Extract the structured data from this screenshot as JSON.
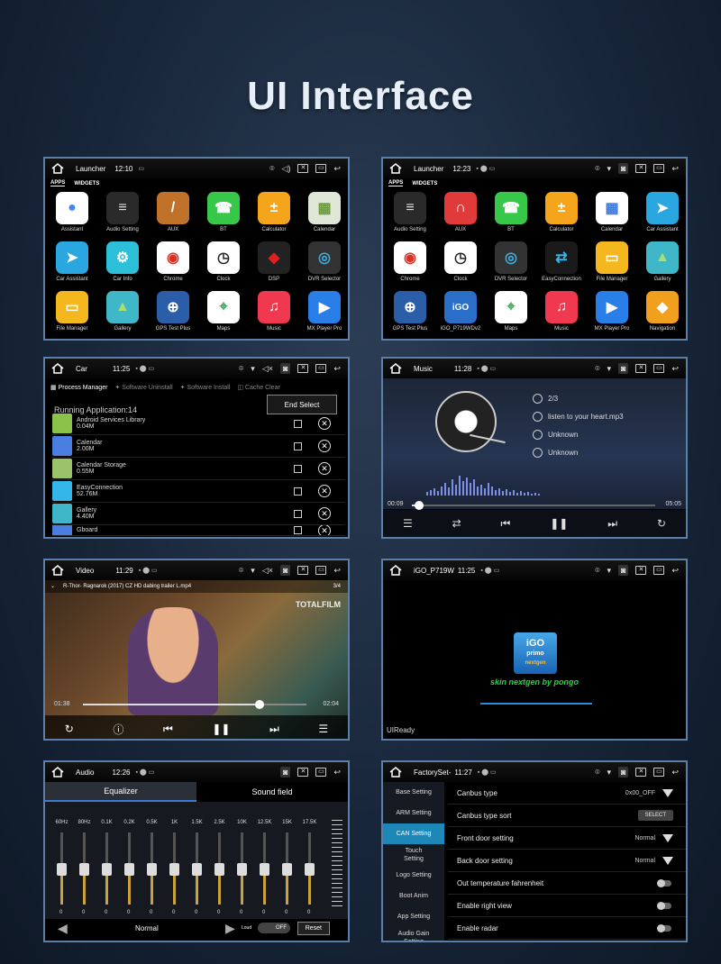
{
  "page": {
    "title": "UI Interface"
  },
  "launcher1": {
    "title": "Launcher",
    "time": "12:10",
    "tabs": [
      "APPS",
      "WIDGETS"
    ],
    "apps": [
      {
        "label": "Assistant",
        "bg": "#ffffff",
        "glyph": "●",
        "fg": "#4285f4"
      },
      {
        "label": "Audio Setting",
        "bg": "#2a2a2a",
        "glyph": "≡",
        "fg": "#ddd"
      },
      {
        "label": "AUX",
        "bg": "#c0722a",
        "glyph": "/",
        "fg": "#fff"
      },
      {
        "label": "BT",
        "bg": "#37c84a",
        "glyph": "☎",
        "fg": "#fff"
      },
      {
        "label": "Calculator",
        "bg": "#f4a51c",
        "glyph": "±",
        "fg": "#fff"
      },
      {
        "label": "Calendar",
        "bg": "#dfe8d6",
        "glyph": "▦",
        "fg": "#6a9a3a"
      },
      {
        "label": "Car Assistant",
        "bg": "#2aa6e0",
        "glyph": "➤",
        "fg": "#fff"
      },
      {
        "label": "Car Info",
        "bg": "#2bc0d8",
        "glyph": "⚙",
        "fg": "#fff"
      },
      {
        "label": "Chrome",
        "bg": "#ffffff",
        "glyph": "◉",
        "fg": "#d93025"
      },
      {
        "label": "Clock",
        "bg": "#ffffff",
        "glyph": "◷",
        "fg": "#222"
      },
      {
        "label": "DSP",
        "bg": "#222222",
        "glyph": "◆",
        "fg": "#e02020"
      },
      {
        "label": "DVR Selector",
        "bg": "#333333",
        "glyph": "◎",
        "fg": "#3fb0e0"
      },
      {
        "label": "File Manager",
        "bg": "#f5b71e",
        "glyph": "▭",
        "fg": "#fff"
      },
      {
        "label": "Gallery",
        "bg": "#3fb7c8",
        "glyph": "▲",
        "fg": "#a8e06a"
      },
      {
        "label": "GPS Test Plus",
        "bg": "#2a5ea8",
        "glyph": "⊕",
        "fg": "#fff"
      },
      {
        "label": "Maps",
        "bg": "#ffffff",
        "glyph": "⌖",
        "fg": "#34a853"
      },
      {
        "label": "Music",
        "bg": "#f0384e",
        "glyph": "♫",
        "fg": "#fff"
      },
      {
        "label": "MX Player Pro",
        "bg": "#2a7ee8",
        "glyph": "▶",
        "fg": "#fff"
      }
    ]
  },
  "launcher2": {
    "title": "Launcher",
    "time": "12:23",
    "tabs": [
      "APPS",
      "WIDGETS"
    ],
    "apps": [
      {
        "label": "Audio Setting",
        "bg": "#2a2a2a",
        "glyph": "≡",
        "fg": "#ddd"
      },
      {
        "label": "AUX",
        "bg": "#e03a3a",
        "glyph": "∩",
        "fg": "#fff"
      },
      {
        "label": "BT",
        "bg": "#37c84a",
        "glyph": "☎",
        "fg": "#fff"
      },
      {
        "label": "Calculator",
        "bg": "#f4a51c",
        "glyph": "±",
        "fg": "#fff"
      },
      {
        "label": "Calendar",
        "bg": "#ffffff",
        "glyph": "▦",
        "fg": "#3a78e0"
      },
      {
        "label": "Car Assistant",
        "bg": "#2aa6e0",
        "glyph": "➤",
        "fg": "#fff"
      },
      {
        "label": "Chrome",
        "bg": "#ffffff",
        "glyph": "◉",
        "fg": "#d93025"
      },
      {
        "label": "Clock",
        "bg": "#ffffff",
        "glyph": "◷",
        "fg": "#222"
      },
      {
        "label": "DVR Selector",
        "bg": "#333333",
        "glyph": "◎",
        "fg": "#3fb0e0"
      },
      {
        "label": "EasyConnection",
        "bg": "#1a1a1a",
        "glyph": "⇄",
        "fg": "#35b6e8"
      },
      {
        "label": "File Manager",
        "bg": "#f5b71e",
        "glyph": "▭",
        "fg": "#fff"
      },
      {
        "label": "Gallery",
        "bg": "#3fb7c8",
        "glyph": "▲",
        "fg": "#a8e06a"
      },
      {
        "label": "GPS Test Plus",
        "bg": "#2a5ea8",
        "glyph": "⊕",
        "fg": "#fff"
      },
      {
        "label": "iGO_P719WDv2",
        "bg": "#2a6ec8",
        "glyph": "iGO",
        "fg": "#fff"
      },
      {
        "label": "Maps",
        "bg": "#ffffff",
        "glyph": "⌖",
        "fg": "#34a853"
      },
      {
        "label": "Music",
        "bg": "#f0384e",
        "glyph": "♫",
        "fg": "#fff"
      },
      {
        "label": "MX Player Pro",
        "bg": "#2a7ee8",
        "glyph": "▶",
        "fg": "#fff"
      },
      {
        "label": "Navigation",
        "bg": "#f0a01c",
        "glyph": "◆",
        "fg": "#fff"
      }
    ]
  },
  "car": {
    "title": "Car",
    "time": "11:25",
    "toolbar": [
      "Process Manager",
      "Software Uninstall",
      "Software Install",
      "Cache Clear"
    ],
    "running": "Running Application:14",
    "end_button": "End Select",
    "apps": [
      {
        "name": "Android Services Library",
        "size": "0.04M",
        "color": "#8bc34a"
      },
      {
        "name": "Calendar",
        "size": "2.00M",
        "color": "#4a7ee0"
      },
      {
        "name": "Calendar Storage",
        "size": "0.55M",
        "color": "#9bc36a"
      },
      {
        "name": "EasyConnection",
        "size": "52.76M",
        "color": "#35b6e8"
      },
      {
        "name": "Gallery",
        "size": "4.40M",
        "color": "#3fb7c8"
      },
      {
        "name": "Gboard",
        "size": "",
        "color": "#4a7ee0"
      }
    ]
  },
  "music": {
    "title": "Music",
    "time": "11:28",
    "track": "2/3",
    "song": "listen to your heart.mp3",
    "artist": "Unknown",
    "album": "Unknown",
    "elapsed": "00:09",
    "total": "05:05",
    "progress": 0.03
  },
  "video": {
    "title": "Video",
    "time": "11:29",
    "file": "R-Thor- Ragnarok (2017) CZ HD dabing trailer L.mp4",
    "index": "3/4",
    "brand": "TOTALFILM",
    "elapsed": "01:38",
    "total": "02:04",
    "progress": 0.79
  },
  "igo": {
    "title": "iGO_P719W",
    "time": "11:25",
    "logo_top": "iGO",
    "logo_sub": "primo",
    "logo_side": "nextgen",
    "caption": "skin nextgen by pongo",
    "status": "UIReady"
  },
  "audio": {
    "title": "Audio",
    "time": "12:26",
    "tabs": [
      "Equalizer",
      "Sound field"
    ],
    "bands": [
      "60Hz",
      "80Hz",
      "0.1K",
      "0.2K",
      "0.5K",
      "1K",
      "1.5K",
      "2.5K",
      "10K",
      "12.5K",
      "15K",
      "17.5K"
    ],
    "values": [
      "0",
      "0",
      "0",
      "0",
      "0",
      "0",
      "0",
      "0",
      "0",
      "0",
      "0",
      "0"
    ],
    "preset": "Normal",
    "loud_label": "Loud",
    "loud_state": "OFF",
    "reset": "Reset"
  },
  "factory": {
    "title": "FactorySet-",
    "time": "11:27",
    "menu": [
      "Base Setting",
      "ARM Setting",
      "CAN Setting",
      "Touch Setting",
      "Logo Setting",
      "Boot Anim",
      "App Setting",
      "Audio Gain Setting"
    ],
    "rows": [
      {
        "label": "Canbus type",
        "value": "0x00_OFF",
        "kind": "dropdown"
      },
      {
        "label": "Canbus type sort",
        "value": "SELECT",
        "kind": "button"
      },
      {
        "label": "Front door setting",
        "value": "Normal",
        "kind": "dropdown"
      },
      {
        "label": "Back door setting",
        "value": "Normal",
        "kind": "dropdown"
      },
      {
        "label": "Out temperature fahrenheit",
        "value": "",
        "kind": "toggle"
      },
      {
        "label": "Enable right view",
        "value": "",
        "kind": "toggle"
      },
      {
        "label": "Enable radar",
        "value": "",
        "kind": "toggle"
      }
    ]
  }
}
